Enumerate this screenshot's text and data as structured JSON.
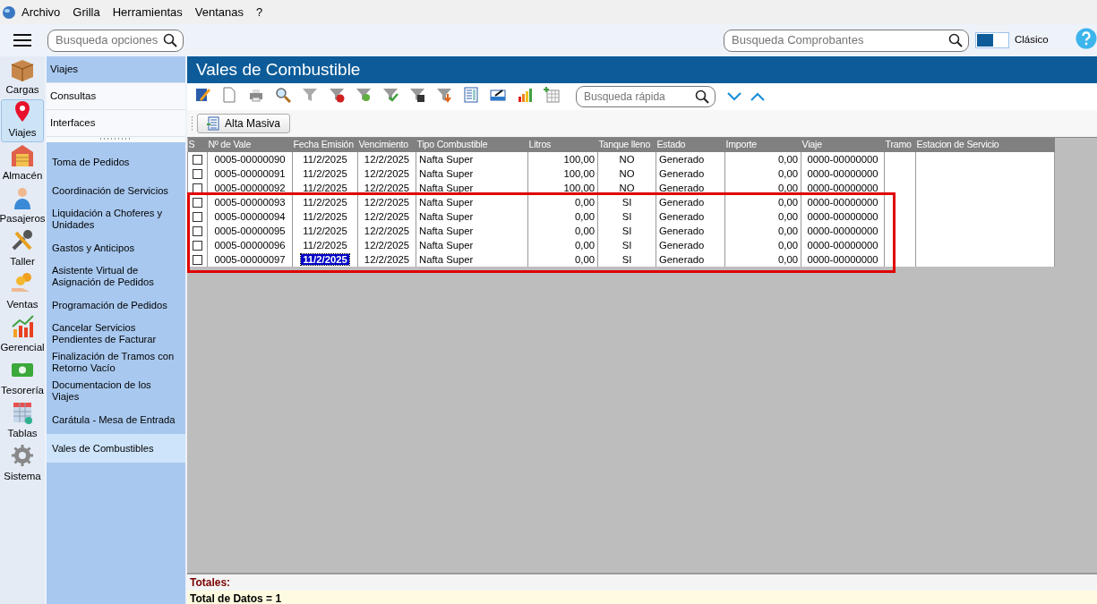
{
  "menu": [
    "Archivo",
    "Grilla",
    "Herramientas",
    "Ventanas",
    "?"
  ],
  "top": {
    "options_search": {
      "placeholder": "Busqueda opciones"
    },
    "vouchers_search": {
      "placeholder": "Busqueda Comprobantes"
    },
    "theme_toggle": {
      "label": "Clásico",
      "on": false
    }
  },
  "rail": [
    {
      "label": "Cargas",
      "selected": false
    },
    {
      "label": "Viajes",
      "selected": true
    },
    {
      "label": "Almacén",
      "selected": false
    },
    {
      "label": "Pasajeros",
      "selected": false
    },
    {
      "label": "Taller",
      "selected": false
    },
    {
      "label": "Ventas",
      "selected": false
    },
    {
      "label": "Gerencial",
      "selected": false
    },
    {
      "label": "Tesorería",
      "selected": false
    },
    {
      "label": "Tablas",
      "selected": false
    },
    {
      "label": "Sistema",
      "selected": false
    }
  ],
  "sections": [
    {
      "label": "Viajes",
      "selected": true
    },
    {
      "label": "Consultas",
      "selected": false
    },
    {
      "label": "Interfaces",
      "selected": false
    }
  ],
  "submenu": [
    {
      "label": "Toma de Pedidos",
      "selected": false
    },
    {
      "label": "Coordinación de Servicios",
      "selected": false
    },
    {
      "label": "Liquidación a Choferes y Unidades",
      "selected": false
    },
    {
      "label": "Gastos y Anticipos",
      "selected": false
    },
    {
      "label": "Asistente Virtual de Asignación de Pedidos",
      "selected": false
    },
    {
      "label": "Programación de Pedidos",
      "selected": false
    },
    {
      "label": "Cancelar Servicios Pendientes de Facturar",
      "selected": false
    },
    {
      "label": "Finalización de Tramos con Retorno Vacío",
      "selected": false
    },
    {
      "label": "Documentacion de los Viajes",
      "selected": false
    },
    {
      "label": "Carátula - Mesa de Entrada",
      "selected": false
    },
    {
      "label": "Vales de Combustibles",
      "selected": true
    }
  ],
  "window": {
    "title": "Vales de Combustible"
  },
  "quick_search": {
    "placeholder": "Busqueda rápida"
  },
  "actions": [
    "Alta Masiva"
  ],
  "table": {
    "select_header": "S",
    "columns": [
      "Nº de Vale",
      "Fecha Emisión",
      "Vencimiento",
      "Tipo Combustible",
      "Litros",
      "Tanque lleno",
      "Estado",
      "Importe",
      "Viaje",
      "Tramo",
      "Estacion de Servicio"
    ],
    "rows": [
      {
        "checked": false,
        "highlighted": false,
        "cells": [
          {
            "text": "0005-00000090",
            "selected": false
          },
          {
            "text": "11/2/2025",
            "selected": false
          },
          {
            "text": "12/2/2025",
            "selected": false
          },
          {
            "text": "Nafta Super",
            "selected": false
          },
          {
            "text": "100,00",
            "selected": false
          },
          {
            "text": "NO",
            "selected": false
          },
          {
            "text": "Generado",
            "selected": false
          },
          {
            "text": "0,00",
            "selected": false
          },
          {
            "text": "0000-00000000",
            "selected": false
          }
        ]
      },
      {
        "checked": false,
        "highlighted": false,
        "cells": [
          {
            "text": "0005-00000091",
            "selected": false
          },
          {
            "text": "11/2/2025",
            "selected": false
          },
          {
            "text": "12/2/2025",
            "selected": false
          },
          {
            "text": "Nafta Super",
            "selected": false
          },
          {
            "text": "100,00",
            "selected": false
          },
          {
            "text": "NO",
            "selected": false
          },
          {
            "text": "Generado",
            "selected": false
          },
          {
            "text": "0,00",
            "selected": false
          },
          {
            "text": "0000-00000000",
            "selected": false
          }
        ]
      },
      {
        "checked": false,
        "highlighted": false,
        "cells": [
          {
            "text": "0005-00000092",
            "selected": false
          },
          {
            "text": "11/2/2025",
            "selected": false
          },
          {
            "text": "12/2/2025",
            "selected": false
          },
          {
            "text": "Nafta Super",
            "selected": false
          },
          {
            "text": "100,00",
            "selected": false
          },
          {
            "text": "NO",
            "selected": false
          },
          {
            "text": "Generado",
            "selected": false
          },
          {
            "text": "0,00",
            "selected": false
          },
          {
            "text": "0000-00000000",
            "selected": false
          }
        ]
      },
      {
        "checked": false,
        "highlighted": true,
        "cells": [
          {
            "text": "0005-00000093",
            "selected": false
          },
          {
            "text": "11/2/2025",
            "selected": false
          },
          {
            "text": "12/2/2025",
            "selected": false
          },
          {
            "text": "Nafta Super",
            "selected": false
          },
          {
            "text": "0,00",
            "selected": false
          },
          {
            "text": "SI",
            "selected": false
          },
          {
            "text": "Generado",
            "selected": false
          },
          {
            "text": "0,00",
            "selected": false
          },
          {
            "text": "0000-00000000",
            "selected": false
          }
        ]
      },
      {
        "checked": false,
        "highlighted": true,
        "cells": [
          {
            "text": "0005-00000094",
            "selected": false
          },
          {
            "text": "11/2/2025",
            "selected": false
          },
          {
            "text": "12/2/2025",
            "selected": false
          },
          {
            "text": "Nafta Super",
            "selected": false
          },
          {
            "text": "0,00",
            "selected": false
          },
          {
            "text": "SI",
            "selected": false
          },
          {
            "text": "Generado",
            "selected": false
          },
          {
            "text": "0,00",
            "selected": false
          },
          {
            "text": "0000-00000000",
            "selected": false
          }
        ]
      },
      {
        "checked": false,
        "highlighted": true,
        "cells": [
          {
            "text": "0005-00000095",
            "selected": false
          },
          {
            "text": "11/2/2025",
            "selected": false
          },
          {
            "text": "12/2/2025",
            "selected": false
          },
          {
            "text": "Nafta Super",
            "selected": false
          },
          {
            "text": "0,00",
            "selected": false
          },
          {
            "text": "SI",
            "selected": false
          },
          {
            "text": "Generado",
            "selected": false
          },
          {
            "text": "0,00",
            "selected": false
          },
          {
            "text": "0000-00000000",
            "selected": false
          }
        ]
      },
      {
        "checked": false,
        "highlighted": true,
        "cells": [
          {
            "text": "0005-00000096",
            "selected": false
          },
          {
            "text": "11/2/2025",
            "selected": false
          },
          {
            "text": "12/2/2025",
            "selected": false
          },
          {
            "text": "Nafta Super",
            "selected": false
          },
          {
            "text": "0,00",
            "selected": false
          },
          {
            "text": "SI",
            "selected": false
          },
          {
            "text": "Generado",
            "selected": false
          },
          {
            "text": "0,00",
            "selected": false
          },
          {
            "text": "0000-00000000",
            "selected": false
          }
        ]
      },
      {
        "checked": false,
        "highlighted": true,
        "cells": [
          {
            "text": "0005-00000097",
            "selected": false
          },
          {
            "text": "11/2/2025",
            "selected": true
          },
          {
            "text": "12/2/2025",
            "selected": false
          },
          {
            "text": "Nafta Super",
            "selected": false
          },
          {
            "text": "0,00",
            "selected": false
          },
          {
            "text": "SI",
            "selected": false
          },
          {
            "text": "Generado",
            "selected": false
          },
          {
            "text": "0,00",
            "selected": false
          },
          {
            "text": "0000-00000000",
            "selected": false
          }
        ]
      }
    ]
  },
  "totals": {
    "title": "Totales:",
    "line": "Total de Datos = 1"
  }
}
